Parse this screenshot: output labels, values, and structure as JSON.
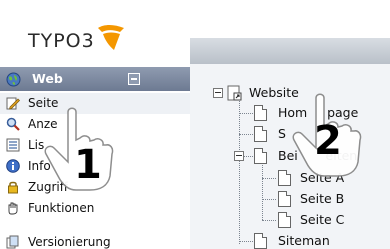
{
  "app": {
    "logo_text": "TYPO3",
    "accent_orange": "#f49700"
  },
  "modules": {
    "group_label": "Web",
    "group_icon": "globe-icon",
    "items": [
      {
        "label": "Seite",
        "icon": "pencil-page-icon",
        "selected": true
      },
      {
        "label": "Anze",
        "icon": "magnifier-icon",
        "selected": false
      },
      {
        "label": "Lis",
        "icon": "list-icon",
        "selected": false
      },
      {
        "label": "Info",
        "icon": "info-icon",
        "selected": false
      },
      {
        "label": "Zugriff",
        "icon": "lock-icon",
        "selected": false
      },
      {
        "label": "Funktionen",
        "icon": "hand-icon",
        "selected": false
      },
      {
        "label": "Versionierung",
        "icon": "versions-icon",
        "selected": false
      }
    ]
  },
  "tree": {
    "root": "Website",
    "nodes": [
      {
        "label": "Hom     page",
        "depth": 1
      },
      {
        "label": "S",
        "depth": 1
      },
      {
        "label": "Bei       eiten",
        "depth": 1
      },
      {
        "label": "Seite A",
        "depth": 2
      },
      {
        "label": "Seite B",
        "depth": 2
      },
      {
        "label": "Seite C",
        "depth": 2
      },
      {
        "label": "Siteman",
        "depth": 1
      }
    ]
  },
  "callouts": {
    "one": "1",
    "two": "2"
  }
}
